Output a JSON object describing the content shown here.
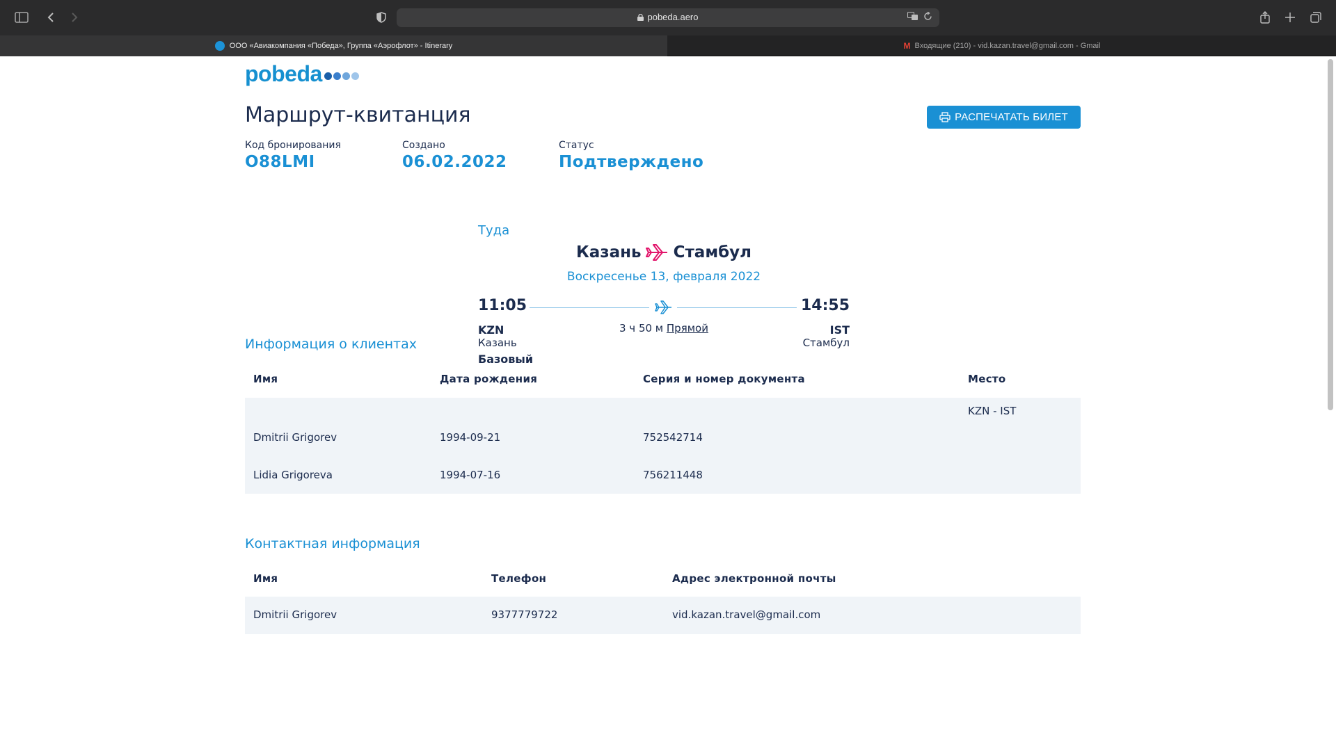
{
  "browser": {
    "url": "pobeda.aero",
    "tabs": [
      {
        "label": "ООО «Авиакомпания «Победа», Группа «Аэрофлот» - Itinerary",
        "active": true
      },
      {
        "label": "Входящие (210) - vid.kazan.travel@gmail.com - Gmail",
        "active": false
      }
    ]
  },
  "brand": {
    "logo_text": "pobeda",
    "accent": "#1a90d4",
    "text_dark": "#1b2b4d",
    "plane_pink": "#e2156b"
  },
  "header": {
    "title": "Маршрут-квитанция",
    "print_label": "РАСПЕЧАТАТЬ БИЛЕТ"
  },
  "booking": {
    "code_label": "Код бронирования",
    "code_value": "O88LMI",
    "created_label": "Создано",
    "created_value": "06.02.2022",
    "status_label": "Статус",
    "status_value": "Подтверждено"
  },
  "flight": {
    "direction": "Туда",
    "from_city": "Казань",
    "to_city": "Стамбул",
    "date": "Воскресенье 13, февраля 2022",
    "dep_time": "11:05",
    "arr_time": "14:55",
    "duration": "3 ч 50 м",
    "stops": "Прямой",
    "dep_code": "KZN",
    "dep_city": "Казань",
    "arr_code": "IST",
    "arr_city": "Стамбул",
    "fare": "Базовый"
  },
  "clients": {
    "title": "Информация о клиентах",
    "headers": [
      "Имя",
      "Дата рождения",
      "Серия и номер документа",
      "Место"
    ],
    "segment": "KZN - IST",
    "rows": [
      {
        "name": "Dmitrii Grigorev",
        "dob": "1994-09-21",
        "doc": "752542714"
      },
      {
        "name": "Lidia Grigoreva",
        "dob": "1994-07-16",
        "doc": "756211448"
      }
    ]
  },
  "contacts": {
    "title": "Контактная информация",
    "headers": [
      "Имя",
      "Телефон",
      "Адрес электронной почты"
    ],
    "rows": [
      {
        "name": "Dmitrii Grigorev",
        "phone": "9377779722",
        "email": "vid.kazan.travel@gmail.com"
      }
    ]
  }
}
